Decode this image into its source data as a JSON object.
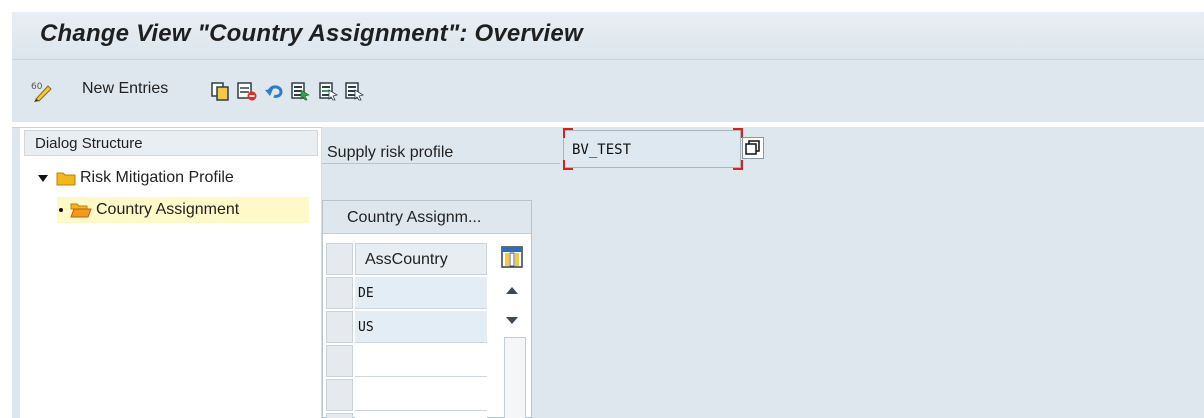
{
  "header": {
    "title": "Change View \"Country Assignment\": Overview"
  },
  "toolbar": {
    "new_entries_label": "New Entries",
    "icons": [
      "display-change-icon",
      "copy-icon",
      "delete-icon",
      "undo-icon",
      "select-all-icon",
      "select-block-icon",
      "deselect-all-icon"
    ]
  },
  "dialog_structure": {
    "title": "Dialog Structure",
    "items": [
      {
        "label": "Risk Mitigation Profile",
        "expanded": true
      },
      {
        "label": "Country Assignment",
        "selected": true
      }
    ]
  },
  "form": {
    "supply_risk_profile_label": "Supply risk profile",
    "supply_risk_profile_value": "BV_TEST"
  },
  "table": {
    "title": "Country Assignm...",
    "column_header": "AssCountry",
    "rows": [
      "DE",
      "US",
      "",
      "",
      ""
    ]
  },
  "colors": {
    "toolbar_bg": "#dfe7ee",
    "selected_tree_bg": "#fff8c8",
    "folder_yellow": "#f2b61e",
    "folder_open_orange": "#f39a1e",
    "required_marker": "#d8201c"
  }
}
